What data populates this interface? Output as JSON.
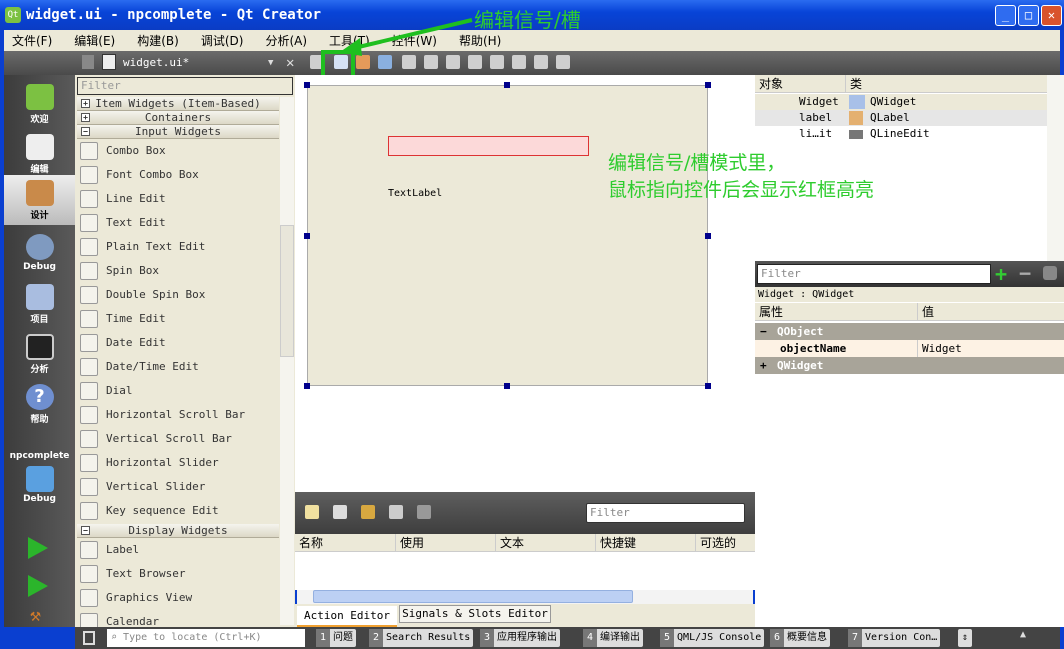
{
  "window": {
    "title": "widget.ui - npcomplete - Qt Creator",
    "buttons": [
      "_",
      "□",
      "✕"
    ]
  },
  "menu": [
    "文件(F)",
    "编辑(E)",
    "构建(B)",
    "调试(D)",
    "分析(A)",
    "工具(T)",
    "控件(W)",
    "帮助(H)"
  ],
  "editor_tab": {
    "file": "widget.ui*"
  },
  "modes": [
    {
      "label": "欢迎",
      "icon": "qt-logo-icon"
    },
    {
      "label": "编辑",
      "icon": "document-icon"
    },
    {
      "label": "设计",
      "icon": "design-pencil-icon"
    },
    {
      "label": "Debug",
      "icon": "bug-icon"
    },
    {
      "label": "项目",
      "icon": "folder-icon"
    },
    {
      "label": "分析",
      "icon": "oscilloscope-icon"
    },
    {
      "label": "帮助",
      "icon": "help-icon"
    }
  ],
  "target": {
    "project": "npcomplete",
    "config": "Debug"
  },
  "widgetbox": {
    "filter_placeholder": "Filter",
    "categories": [
      "Item Widgets (Item-Based)",
      "Containers",
      "Input Widgets",
      "Display Widgets"
    ],
    "input_widgets": [
      "Combo Box",
      "Font Combo Box",
      "Line Edit",
      "Text Edit",
      "Plain Text Edit",
      "Spin Box",
      "Double Spin Box",
      "Time Edit",
      "Date Edit",
      "Date/Time Edit",
      "Dial",
      "Horizontal Scroll Bar",
      "Vertical Scroll Bar",
      "Horizontal Slider",
      "Vertical Slider",
      "Key sequence Edit"
    ],
    "display_widgets": [
      "Label",
      "Text Browser",
      "Graphics View",
      "Calendar"
    ]
  },
  "form": {
    "label_text": "TextLabel"
  },
  "annotations": {
    "title": "编辑信号/槽",
    "note_line1": "编辑信号/槽模式里，",
    "note_line2": "鼠标指向控件后会显示红框高亮",
    "color": "#2ecc2e"
  },
  "action_editor": {
    "filter_placeholder": "Filter",
    "columns": [
      "名称",
      "使用",
      "文本",
      "快捷键",
      "可选的"
    ],
    "tabs": [
      "Action Editor",
      "Signals & Slots Editor"
    ]
  },
  "object_inspector": {
    "columns": [
      "对象",
      "类"
    ],
    "rows": [
      {
        "name": "Widget",
        "class": "QWidget"
      },
      {
        "name": "label",
        "class": "QLabel"
      },
      {
        "name": "li…it",
        "class": "QLineEdit"
      }
    ]
  },
  "property_editor": {
    "filter_placeholder": "Filter",
    "context": "Widget : QWidget",
    "columns": [
      "属性",
      "值"
    ],
    "groups": [
      {
        "name": "QObject",
        "props": [
          {
            "name": "objectName",
            "value": "Widget"
          }
        ]
      },
      {
        "name": "QWidget"
      }
    ]
  },
  "statusbar": {
    "locate_placeholder": "Type to locate (Ctrl+K)",
    "panes": [
      {
        "n": "1",
        "label": "问题"
      },
      {
        "n": "2",
        "label": "Search Results"
      },
      {
        "n": "3",
        "label": "应用程序输出"
      },
      {
        "n": "4",
        "label": "编译输出"
      },
      {
        "n": "5",
        "label": "QML/JS Console"
      },
      {
        "n": "6",
        "label": "概要信息"
      },
      {
        "n": "7",
        "label": "Version Con…"
      }
    ]
  }
}
